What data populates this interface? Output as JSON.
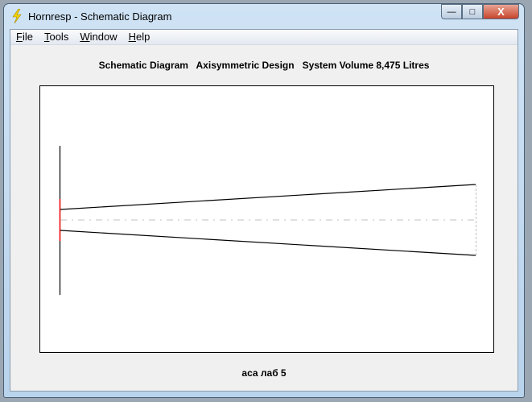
{
  "window": {
    "title": "Hornresp - Schematic Diagram",
    "controls": {
      "minimize": "—",
      "maximize": "□",
      "close": "X"
    }
  },
  "menu": [
    {
      "label": "File",
      "key": "F",
      "rest": "ile"
    },
    {
      "label": "Tools",
      "key": "T",
      "rest": "ools"
    },
    {
      "label": "Window",
      "key": "W",
      "rest": "indow"
    },
    {
      "label": "Help",
      "key": "H",
      "rest": "elp"
    }
  ],
  "heading": "Schematic Diagram   Axisymmetric Design   System Volume 8,475 Litres",
  "footer": "аса лаб 5",
  "colors": {
    "driver": "#ff0000",
    "horn": "#000000",
    "axis": "#c0c0c0"
  }
}
